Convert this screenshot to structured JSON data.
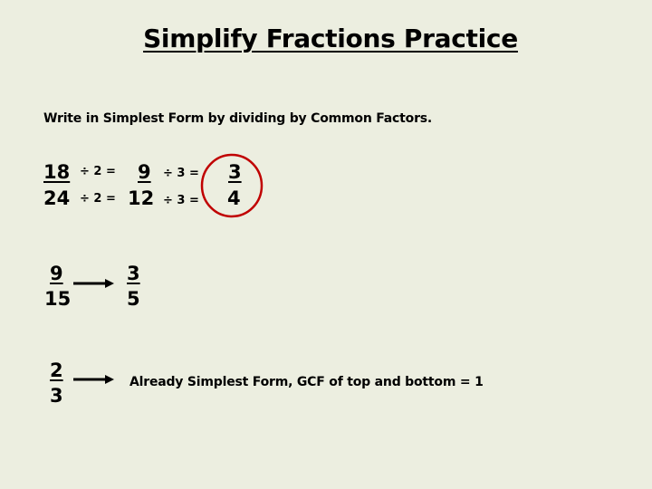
{
  "title": "Simplify Fractions Practice",
  "instruction": "Write in Simplest Form by dividing by Common Factors.",
  "example1": {
    "start": {
      "numerator": "18",
      "denominator": "24"
    },
    "step1": {
      "num_op": "÷ 2 =",
      "den_op": "÷ 2 ="
    },
    "middle": {
      "numerator": "9",
      "denominator": "12"
    },
    "step2": {
      "num_op": "÷ 3 =",
      "den_op": "÷ 3 ="
    },
    "result": {
      "numerator": "3",
      "denominator": "4"
    },
    "circle_color": "#C00000"
  },
  "example2": {
    "start": {
      "numerator": "9",
      "denominator": "15"
    },
    "result": {
      "numerator": "3",
      "denominator": "5"
    }
  },
  "example3": {
    "start": {
      "numerator": "2",
      "denominator": "3"
    },
    "note": "Already Simplest Form, GCF of top and bottom = 1"
  }
}
